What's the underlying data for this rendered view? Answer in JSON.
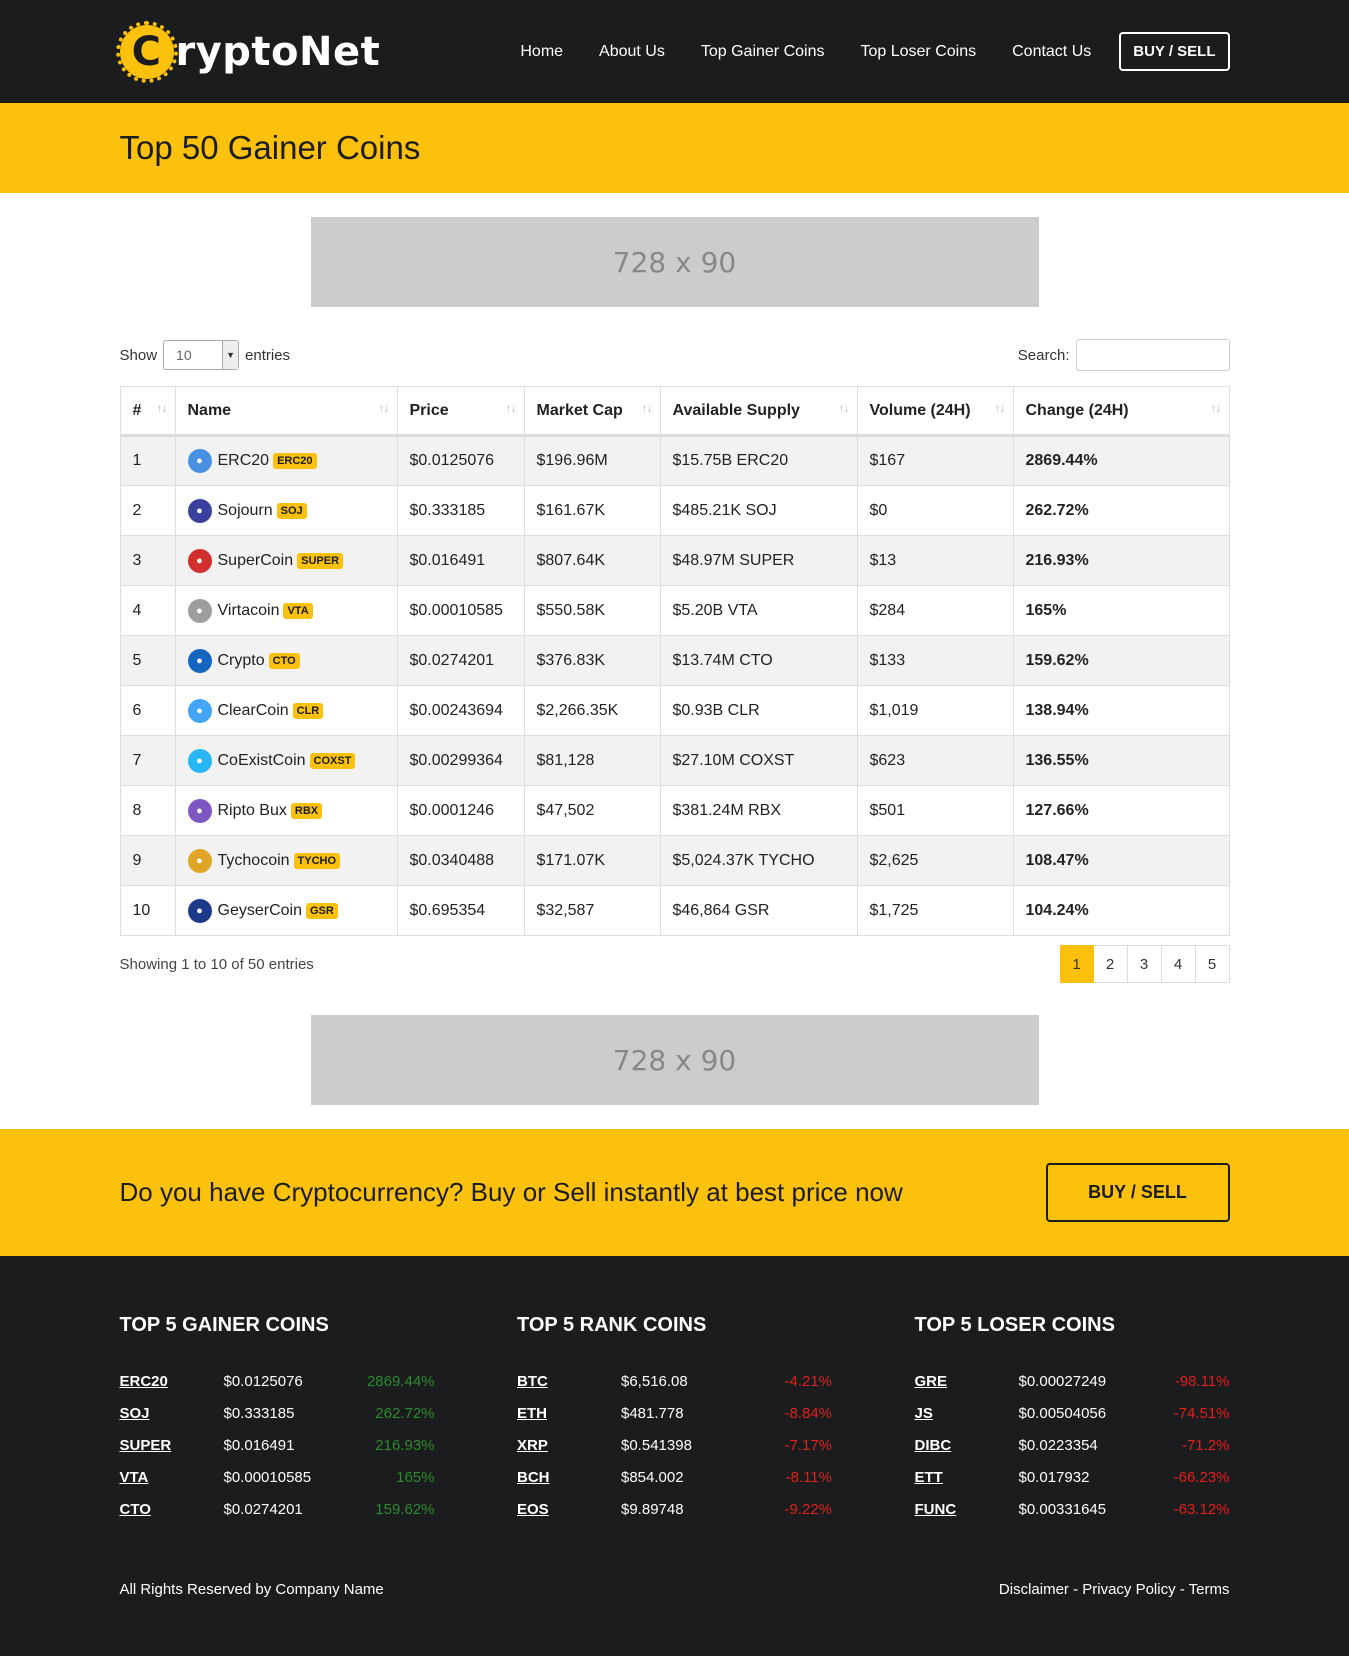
{
  "header": {
    "logo_c": "C",
    "logo_text": "ryptoNet",
    "nav": [
      "Home",
      "About Us",
      "Top Gainer Coins",
      "Top Loser Coins",
      "Contact Us"
    ],
    "buy_sell": "BUY / SELL"
  },
  "page_title": "Top 50 Gainer Coins",
  "ad_label": "728 x 90",
  "controls": {
    "show": "Show",
    "length_value": "10",
    "entries": "entries",
    "search_label": "Search:"
  },
  "table": {
    "columns": [
      "#",
      "Name",
      "Price",
      "Market Cap",
      "Available Supply",
      "Volume (24H)",
      "Change (24H)"
    ],
    "rows": [
      {
        "rank": "1",
        "name": "ERC20",
        "symbol": "ERC20",
        "price": "$0.0125076",
        "market_cap": "$196.96M",
        "supply": "$15.75B ERC20",
        "volume": "$167",
        "change": "2869.44%",
        "icon_color": "#4a90e2"
      },
      {
        "rank": "2",
        "name": "Sojourn",
        "symbol": "SOJ",
        "price": "$0.333185",
        "market_cap": "$161.67K",
        "supply": "$485.21K SOJ",
        "volume": "$0",
        "change": "262.72%",
        "icon_color": "#3b3f9e"
      },
      {
        "rank": "3",
        "name": "SuperCoin",
        "symbol": "SUPER",
        "price": "$0.016491",
        "market_cap": "$807.64K",
        "supply": "$48.97M SUPER",
        "volume": "$13",
        "change": "216.93%",
        "icon_color": "#d32f2f"
      },
      {
        "rank": "4",
        "name": "Virtacoin",
        "symbol": "VTA",
        "price": "$0.00010585",
        "market_cap": "$550.58K",
        "supply": "$5.20B VTA",
        "volume": "$284",
        "change": "165%",
        "icon_color": "#9e9e9e"
      },
      {
        "rank": "5",
        "name": "Crypto",
        "symbol": "CTO",
        "price": "$0.0274201",
        "market_cap": "$376.83K",
        "supply": "$13.74M CTO",
        "volume": "$133",
        "change": "159.62%",
        "icon_color": "#1565c0"
      },
      {
        "rank": "6",
        "name": "ClearCoin",
        "symbol": "CLR",
        "price": "$0.00243694",
        "market_cap": "$2,266.35K",
        "supply": "$0.93B CLR",
        "volume": "$1,019",
        "change": "138.94%",
        "icon_color": "#42a5f5"
      },
      {
        "rank": "7",
        "name": "CoExistCoin",
        "symbol": "COXST",
        "price": "$0.00299364",
        "market_cap": "$81,128",
        "supply": "$27.10M COXST",
        "volume": "$623",
        "change": "136.55%",
        "icon_color": "#29b6f6"
      },
      {
        "rank": "8",
        "name": "Ripto Bux",
        "symbol": "RBX",
        "price": "$0.0001246",
        "market_cap": "$47,502",
        "supply": "$381.24M RBX",
        "volume": "$501",
        "change": "127.66%",
        "icon_color": "#7e57c2"
      },
      {
        "rank": "9",
        "name": "Tychocoin",
        "symbol": "TYCHO",
        "price": "$0.0340488",
        "market_cap": "$171.07K",
        "supply": "$5,024.37K TYCHO",
        "volume": "$2,625",
        "change": "108.47%",
        "icon_color": "#e0a526"
      },
      {
        "rank": "10",
        "name": "GeyserCoin",
        "symbol": "GSR",
        "price": "$0.695354",
        "market_cap": "$32,587",
        "supply": "$46,864 GSR",
        "volume": "$1,725",
        "change": "104.24%",
        "icon_color": "#1e3a8a"
      }
    ]
  },
  "table_info": "Showing 1 to 10 of 50 entries",
  "pagination": [
    "1",
    "2",
    "3",
    "4",
    "5"
  ],
  "cta": {
    "text": "Do you have Cryptocurrency? Buy or Sell instantly at best price now",
    "button": "BUY / SELL"
  },
  "footer": {
    "columns": [
      {
        "title": "TOP 5 GAINER COINS",
        "items": [
          {
            "sym": "ERC20",
            "price": "$0.0125076",
            "change": "2869.44%",
            "dir": "up"
          },
          {
            "sym": "SOJ",
            "price": "$0.333185",
            "change": "262.72%",
            "dir": "up"
          },
          {
            "sym": "SUPER",
            "price": "$0.016491",
            "change": "216.93%",
            "dir": "up"
          },
          {
            "sym": "VTA",
            "price": "$0.00010585",
            "change": "165%",
            "dir": "up"
          },
          {
            "sym": "CTO",
            "price": "$0.0274201",
            "change": "159.62%",
            "dir": "up"
          }
        ]
      },
      {
        "title": "TOP 5 RANK COINS",
        "items": [
          {
            "sym": "BTC",
            "price": "$6,516.08",
            "change": "-4.21%",
            "dir": "down"
          },
          {
            "sym": "ETH",
            "price": "$481.778",
            "change": "-8.84%",
            "dir": "down"
          },
          {
            "sym": "XRP",
            "price": "$0.541398",
            "change": "-7.17%",
            "dir": "down"
          },
          {
            "sym": "BCH",
            "price": "$854.002",
            "change": "-8.11%",
            "dir": "down"
          },
          {
            "sym": "EOS",
            "price": "$9.89748",
            "change": "-9.22%",
            "dir": "down"
          }
        ]
      },
      {
        "title": "TOP 5 LOSER COINS",
        "items": [
          {
            "sym": "GRE",
            "price": "$0.00027249",
            "change": "-98.11%",
            "dir": "down"
          },
          {
            "sym": "JS",
            "price": "$0.00504056",
            "change": "-74.51%",
            "dir": "down"
          },
          {
            "sym": "DIBC",
            "price": "$0.0223354",
            "change": "-71.2%",
            "dir": "down"
          },
          {
            "sym": "ETT",
            "price": "$0.017932",
            "change": "-66.23%",
            "dir": "down"
          },
          {
            "sym": "FUNC",
            "price": "$0.00331645",
            "change": "-63.12%",
            "dir": "down"
          }
        ]
      }
    ],
    "copyright": "All Rights Reserved by Company Name",
    "links": "Disclaimer - Privacy Policy - Terms"
  },
  "colors": {
    "accent": "#fbc10c",
    "dark": "#1b1c1e",
    "positive": "#2e8b2e",
    "negative": "#e0201c"
  }
}
